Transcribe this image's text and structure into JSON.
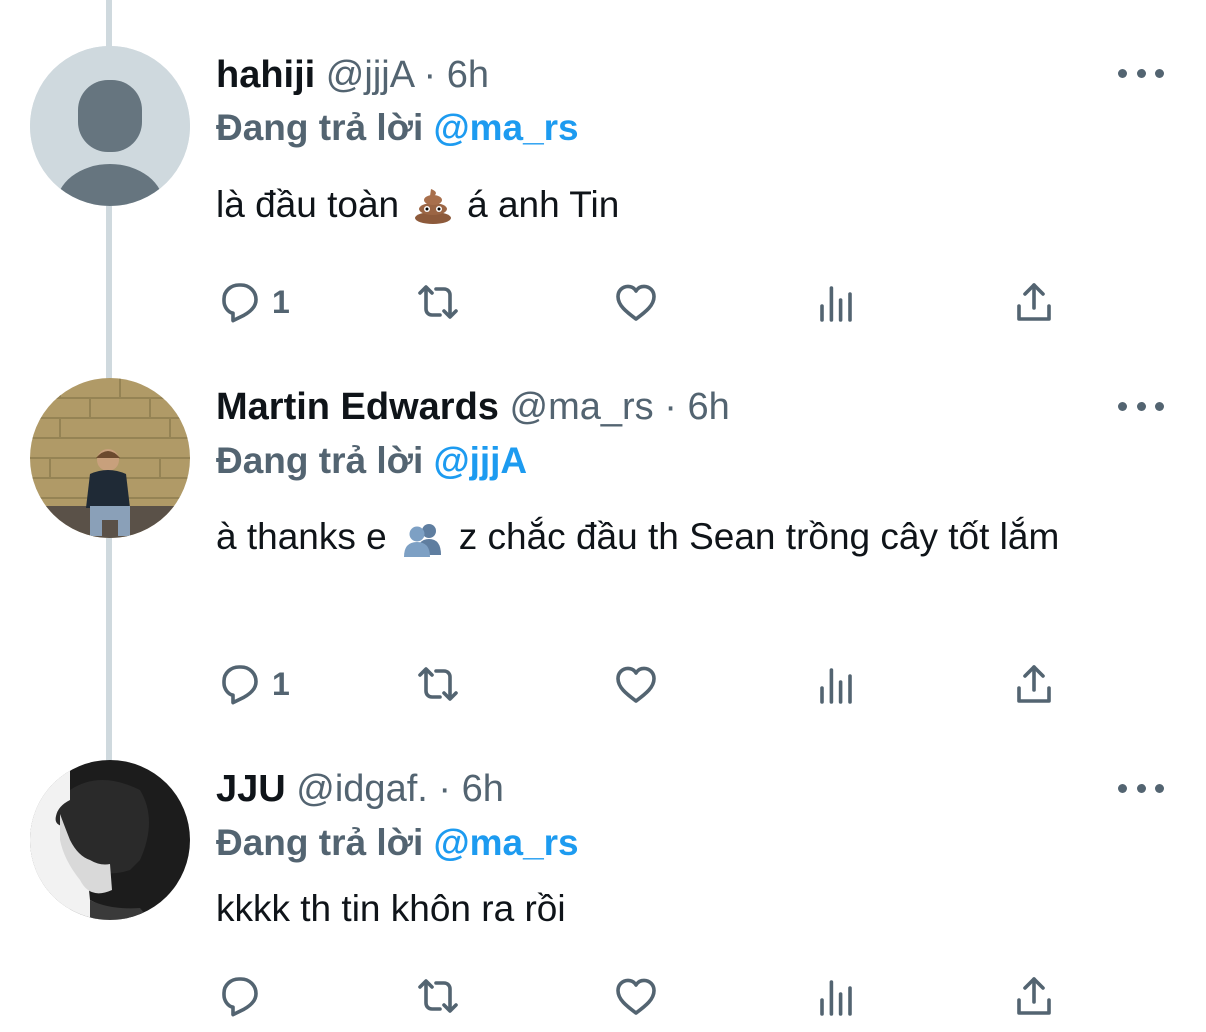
{
  "tweets": [
    {
      "name": "hahiji",
      "handle": "@jjjA",
      "time": "6h",
      "reply_prefix": "Đang trả lời",
      "reply_to": "@ma_rs",
      "text_before": "là đầu toàn",
      "emoji": "pile-of-poo",
      "text_after": "á anh Tin",
      "reply_count": "1",
      "avatar": "default-avatar"
    },
    {
      "name": "Martin Edwards",
      "handle": "@ma_rs",
      "time": "6h",
      "reply_prefix": "Đang trả lời",
      "reply_to": "@jjjA",
      "text_before": "à thanks e",
      "emoji": "busts-in-silhouette",
      "text_after": "z chắc đầu th Sean trồng cây tốt lắm",
      "reply_count": "1",
      "avatar": "photo-person-sitting-against-brick-wall"
    },
    {
      "name": "JJU",
      "handle": "@idgaf.",
      "time": "6h",
      "reply_prefix": "Đang trả lời",
      "reply_to": "@ma_rs",
      "text": "kkkk th tin khôn ra rồi",
      "reply_count": "",
      "avatar": "photo-black-white-profile"
    }
  ],
  "separator": "·",
  "colors": {
    "mention": "#1d9bf0",
    "secondary": "#536471",
    "thread_line": "#cfd9de"
  }
}
